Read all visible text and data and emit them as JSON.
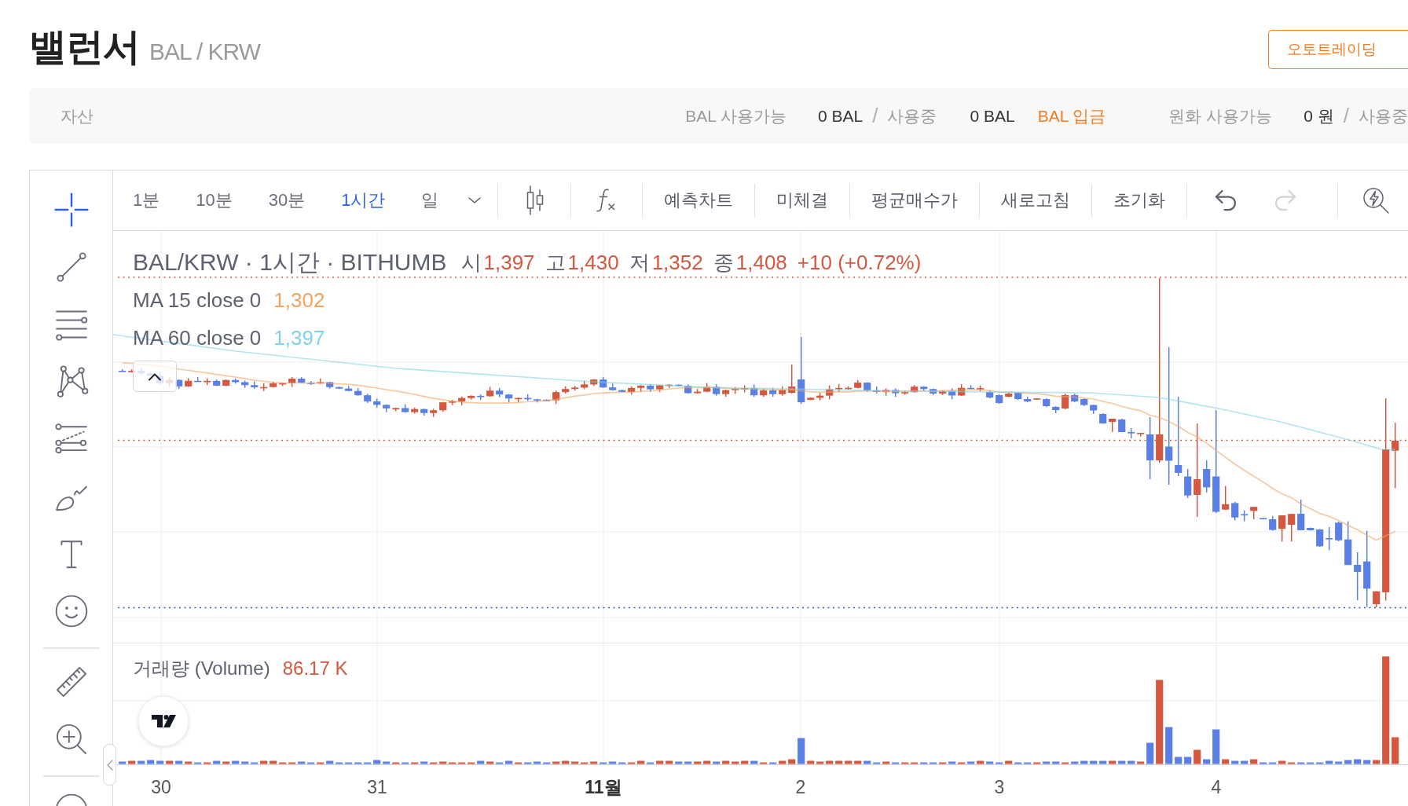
{
  "header": {
    "title": "밸런서",
    "pair": "BAL / KRW",
    "action_button": "오토트레이딩"
  },
  "assets": {
    "title": "자산",
    "groups": [
      {
        "available_label": "BAL 사용가능",
        "available": "0 BAL",
        "separator": "/",
        "in_use_label": "사용중",
        "in_use": "0 BAL",
        "deposit_link": "BAL 입금"
      },
      {
        "available_label": "원화 사용가능",
        "available": "0 원",
        "separator": "/",
        "in_use_label": "사용중"
      }
    ]
  },
  "drawing_tool_groups": [
    {
      "tools": [
        {
          "kind": "crosshair",
          "selected": true
        },
        {
          "kind": "trend-line",
          "selected": false
        },
        {
          "kind": "horizontal-lines",
          "selected": false
        },
        {
          "kind": "pattern",
          "selected": false
        },
        {
          "kind": "projection",
          "selected": false
        },
        {
          "kind": "brush",
          "selected": false
        },
        {
          "kind": "text",
          "selected": false
        },
        {
          "kind": "emoji",
          "selected": false
        }
      ]
    },
    {
      "tools": [
        {
          "kind": "ruler",
          "selected": false
        },
        {
          "kind": "zoom",
          "selected": false
        }
      ]
    },
    {
      "tools": [
        {
          "kind": "circle",
          "selected": false
        }
      ]
    }
  ],
  "toolbar": {
    "intervals": [
      {
        "label": "1분",
        "selected": false
      },
      {
        "label": "10분",
        "selected": false
      },
      {
        "label": "30분",
        "selected": false
      },
      {
        "label": "1시간",
        "selected": true
      },
      {
        "label": "일",
        "selected": false
      }
    ],
    "actions": [
      "예측차트",
      "미체결",
      "평균매수가",
      "새로고침",
      "초기화"
    ],
    "history": [
      {
        "kind": "undo",
        "disabled": false
      },
      {
        "kind": "redo",
        "disabled": true
      }
    ]
  },
  "chart": {
    "legend": {
      "symbol": "BAL/KRW · 1시간 · BITHUMB",
      "ohlc": [
        {
          "label": "시",
          "value": "1,397"
        },
        {
          "label": "고",
          "value": "1,430"
        },
        {
          "label": "저",
          "value": "1,352"
        },
        {
          "label": "종",
          "value": "1,408"
        }
      ],
      "change": "+10 (+0.72%)"
    },
    "indicators": [
      {
        "name": "MA 15 close 0",
        "value": "1,302",
        "color": "#f4a35e"
      },
      {
        "name": "MA 60 close 0",
        "value": "1,397",
        "color": "#7fd3e6"
      }
    ],
    "volume": {
      "name": "거래량 (Volume)",
      "value": "86.17 K"
    },
    "x_axis": [
      {
        "label": "30",
        "kind": "day"
      },
      {
        "label": "31",
        "kind": "day"
      },
      {
        "label": "11월",
        "kind": "month"
      },
      {
        "label": "2",
        "kind": "day"
      },
      {
        "label": "3",
        "kind": "day"
      },
      {
        "label": "4",
        "kind": "day"
      }
    ]
  }
}
